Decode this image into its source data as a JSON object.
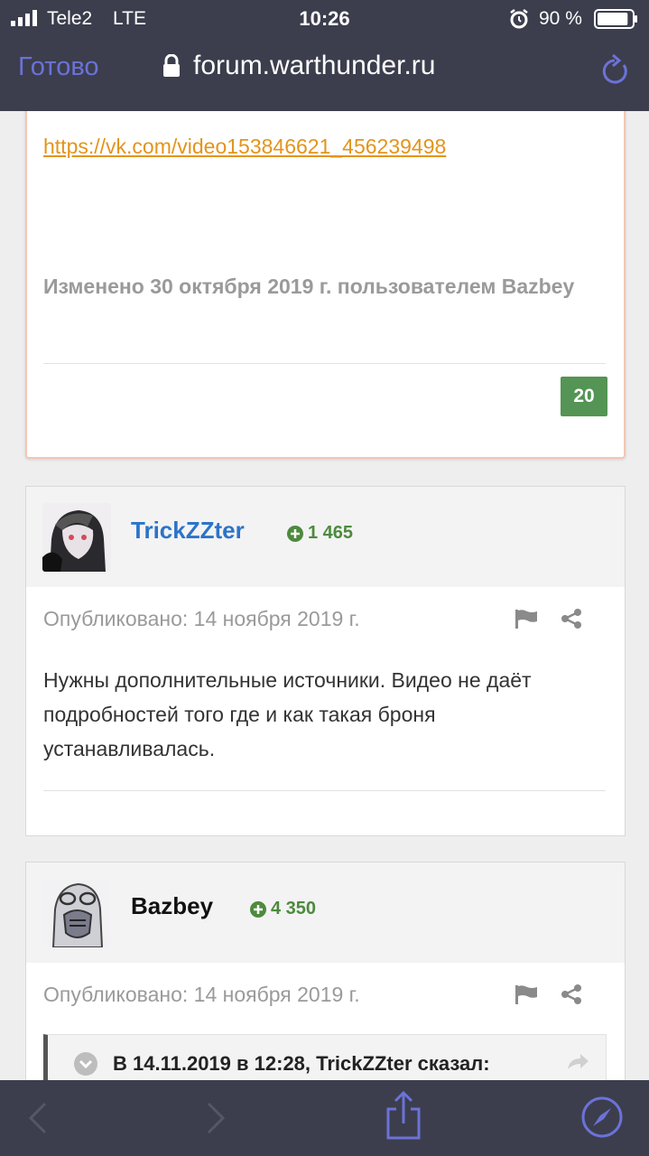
{
  "status_bar": {
    "carrier": "Tele2",
    "network": "LTE",
    "time": "10:26",
    "battery_percent": "90 %",
    "battery_level": 0.9
  },
  "browser": {
    "done_label": "Готово",
    "url": "forum.warthunder.ru"
  },
  "first_post": {
    "link_text": "https://vk.com/video153846621_456239498",
    "edited_text": "Изменено 30 октября 2019 г. пользователем Bazbey",
    "reputation": "20"
  },
  "post_trickzzter": {
    "author": "TrickZZter",
    "reputation": "1 465",
    "posted": "Опубликовано: 14 ноября 2019 г.",
    "text": "Нужны дополнительные источники. Видео не даёт подробностей того где и как такая броня устанавливалась."
  },
  "post_bazbey": {
    "author": "Bazbey",
    "reputation": "4 350",
    "posted": "Опубликовано: 14 ноября 2019 г.",
    "quote_header": "В 14.11.2019 в 12:28, TrickZZter сказал:"
  },
  "colors": {
    "chrome": "#3c3e4d",
    "done_link": "#6b72d8",
    "author_link": "#2c73c9",
    "reputation_green": "#4d8a3e",
    "badge_green": "#549454",
    "vk_link": "#e3941b"
  },
  "icons": [
    "signal-icon",
    "alarm-icon",
    "battery-icon",
    "lock-icon",
    "reload-icon",
    "plus-circle-icon",
    "flag-icon",
    "share-icon",
    "chevron-down-icon",
    "reply-arrow-icon",
    "back-icon",
    "forward-icon",
    "share-up-icon",
    "compass-icon"
  ]
}
